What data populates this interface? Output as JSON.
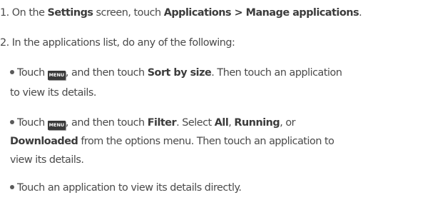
{
  "steps": {
    "step1": {
      "prefix": "1. On the ",
      "settings": "Settings",
      "mid": " screen, touch ",
      "path": "Applications > Manage applications",
      "end": "."
    },
    "step2": {
      "text": "2. In the applications list, do any of the following:"
    }
  },
  "bullets": {
    "b1": {
      "touch": "Touch ",
      "menu_key": "MENU",
      "and_touch": ", and then touch ",
      "option": "Sort by size",
      "rest": ". Then touch an application",
      "line2": "to view its details."
    },
    "b2": {
      "touch": "Touch ",
      "menu_key": "MENU",
      "and_touch": ", and then touch ",
      "option": "Filter",
      "select": ". Select ",
      "all": "All",
      "comma1": ", ",
      "running": "Running",
      "comma_or": ", or",
      "downloaded": "Downloaded",
      "line2_rest": " from the options menu. Then touch an application to",
      "line3": "view its details."
    },
    "b3": {
      "text": "Touch an application to view its details directly."
    }
  }
}
